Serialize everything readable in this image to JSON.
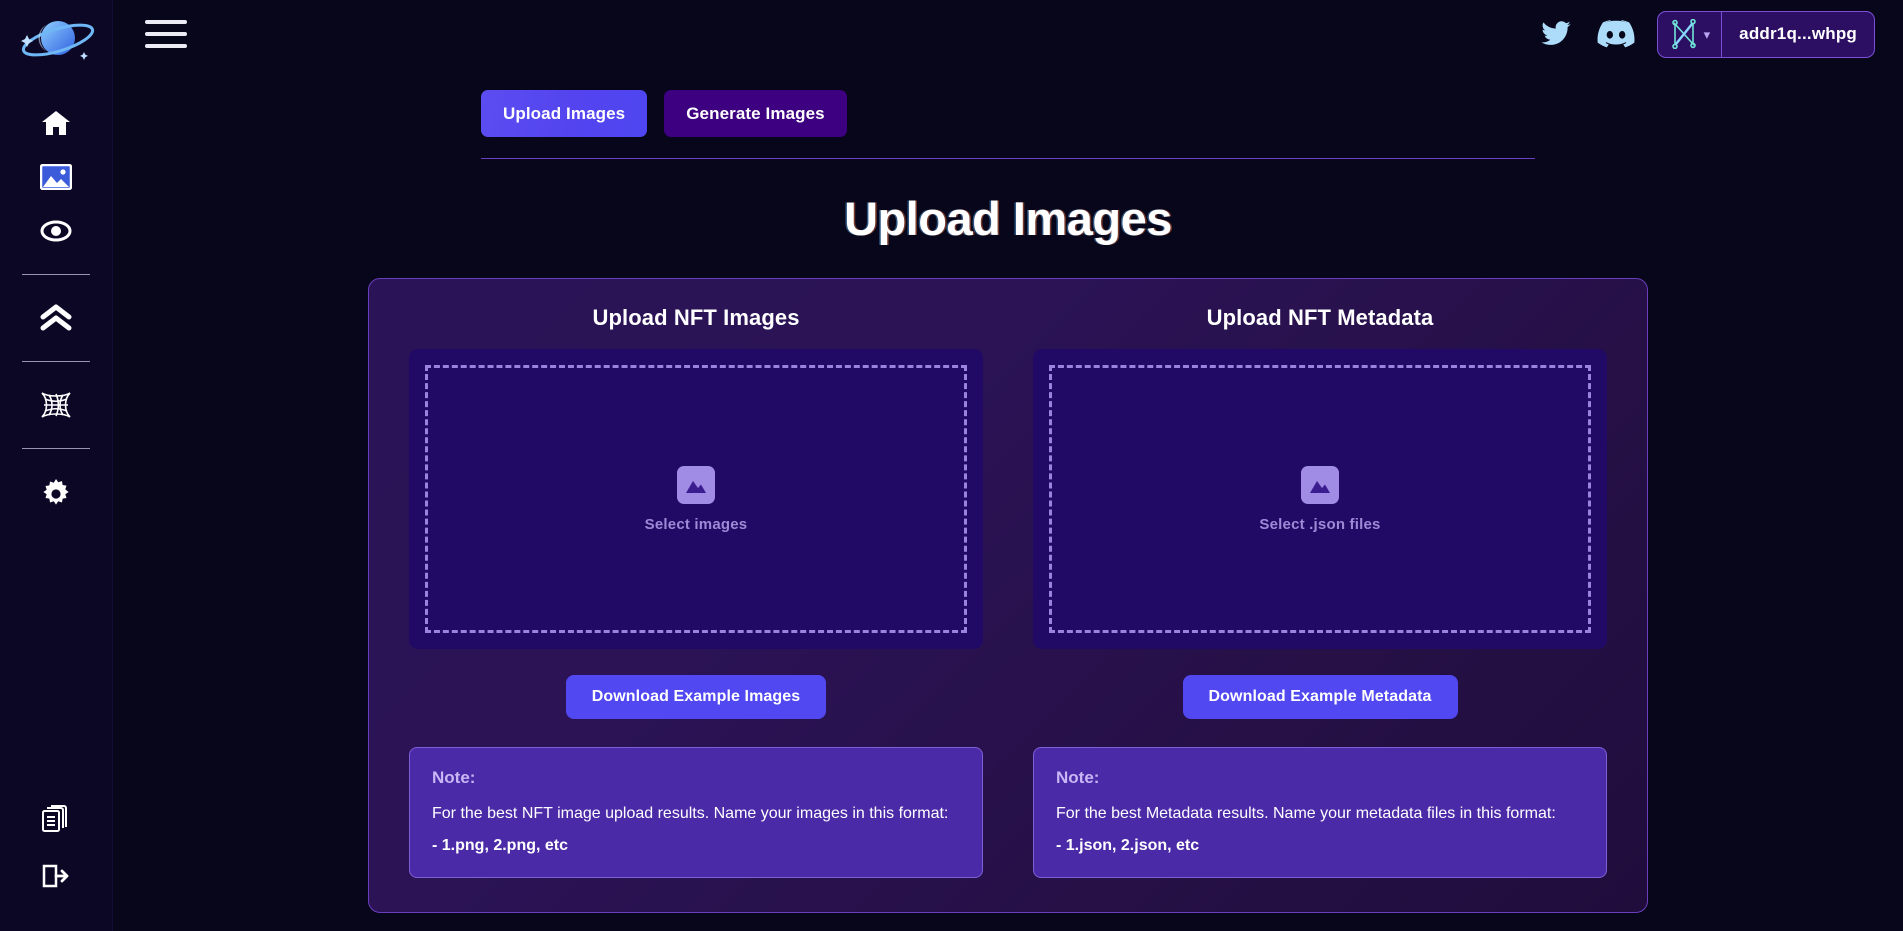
{
  "brand": {
    "logo_icon": "saturn-planet-logo"
  },
  "sidebar": {
    "items": [
      {
        "icon": "home-icon",
        "name": "sidebar-item-home",
        "active": false
      },
      {
        "icon": "image-icon",
        "name": "sidebar-item-images",
        "active": true
      },
      {
        "icon": "eye-icon",
        "name": "sidebar-item-view",
        "active": false
      },
      {
        "icon": "chevrons-up-icon",
        "name": "sidebar-item-upgrade",
        "active": false
      },
      {
        "icon": "wormhole-icon",
        "name": "sidebar-item-portal",
        "active": false
      },
      {
        "icon": "gear-icon",
        "name": "sidebar-item-settings",
        "active": false
      }
    ],
    "bottom_items": [
      {
        "icon": "documents-icon",
        "name": "sidebar-item-docs"
      },
      {
        "icon": "logout-icon",
        "name": "sidebar-item-logout"
      }
    ]
  },
  "topbar": {
    "menu_icon": "hamburger-menu-icon",
    "twitter_icon": "twitter-icon",
    "discord_icon": "discord-icon",
    "wallet": {
      "icon": "nami-wallet-icon",
      "chevron": "chevron-down-icon",
      "address": "addr1q...whpg"
    }
  },
  "tabs": [
    {
      "label": "Upload Images",
      "active": true
    },
    {
      "label": "Generate Images",
      "active": false
    }
  ],
  "page": {
    "title": "Upload Images"
  },
  "columns": [
    {
      "title": "Upload NFT Images",
      "dropzone": {
        "icon": "image-placeholder-icon",
        "label": "Select images"
      },
      "download_label": "Download Example Images",
      "note": {
        "title": "Note:",
        "body": "For the best NFT image upload results. Name your images in this format:",
        "format": "- 1.png, 2.png, etc"
      }
    },
    {
      "title": "Upload NFT Metadata",
      "dropzone": {
        "icon": "image-placeholder-icon",
        "label": "Select .json files"
      },
      "download_label": "Download Example Metadata",
      "note": {
        "title": "Note:",
        "body": "For the best Metadata results. Name your metadata files in this format:",
        "format": "- 1.json, 2.json, etc"
      }
    }
  ],
  "colors": {
    "page_bg": "#07061a",
    "sidebar_bg": "#0d0726",
    "accent_blue": "#5148f2",
    "accent_purple": "#3d0080",
    "card_border": "#6a3fbd",
    "dropzone_bg": "#210a66",
    "dash_border": "#9a82e0",
    "note_bg": "#4b2aa8",
    "divider": "#6d3fc4"
  }
}
